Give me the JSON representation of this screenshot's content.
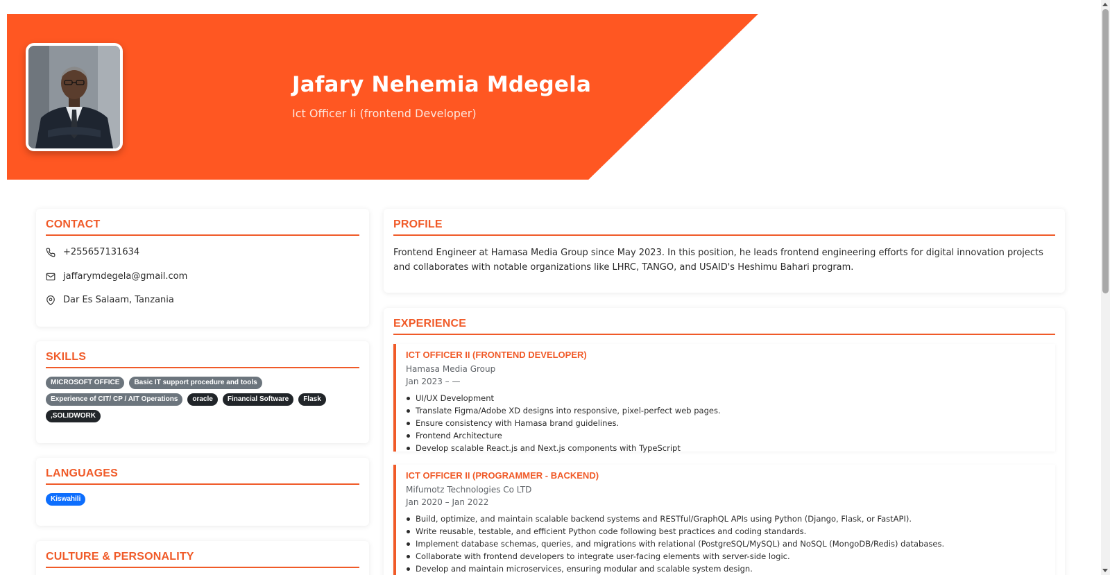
{
  "header": {
    "name": "Jafary Nehemia Mdegela",
    "role": "Ict Officer Ii (frontend Developer)",
    "accent_color": "#ff5722"
  },
  "contact": {
    "title": "CONTACT",
    "phone": "+255657131634",
    "email": "jaffarymdegela@gmail.com",
    "location": "Dar Es Salaam, Tanzania"
  },
  "skills": {
    "title": "SKILLS",
    "items": [
      {
        "label": "MICROSOFT OFFICE",
        "color": "#6c757d"
      },
      {
        "label": "Basic IT support procedure and tools",
        "color": "#6c757d"
      },
      {
        "label": "Experience of CIT/ CP / AIT Operations",
        "color": "#6c757d"
      },
      {
        "label": "oracle",
        "color": "#212529"
      },
      {
        "label": "Financial Software",
        "color": "#212529"
      },
      {
        "label": "Flask",
        "color": "#212529"
      },
      {
        "label": ",SOLIDWORK",
        "color": "#212529"
      }
    ]
  },
  "languages": {
    "title": "LANGUAGES",
    "items": [
      {
        "label": "Kiswahili",
        "color": "#0d6efd"
      }
    ]
  },
  "culture": {
    "title": "CULTURE & PERSONALITY"
  },
  "profile": {
    "title": "PROFILE",
    "text": "Frontend Engineer at Hamasa Media Group since May 2023. In this position, he leads frontend engineering efforts for digital innovation projects and collaborates with notable organizations like LHRC, TANGO, and USAID's Heshimu Bahari program."
  },
  "experience": {
    "title": "EXPERIENCE",
    "jobs": [
      {
        "title": "ICT OFFICER II (FRONTEND DEVELOPER)",
        "company": "Hamasa Media Group",
        "dates": "Jan 2023 – —",
        "bullets": [
          "UI/UX Development",
          "Translate Figma/Adobe XD designs into responsive, pixel-perfect web pages.",
          "Ensure consistency with Hamasa brand guidelines.",
          "Frontend Architecture",
          "Develop scalable React.js and Next.js components with TypeScript"
        ]
      },
      {
        "title": "ICT OFFICER II (PROGRAMMER - BACKEND)",
        "company": "Mifumotz Technologies Co LTD",
        "dates": "Jan 2020 – Jan 2022",
        "bullets": [
          "Build, optimize, and maintain scalable backend systems and RESTful/GraphQL APIs using Python (Django, Flask, or FastAPI).",
          "Write reusable, testable, and efficient Python code following best practices and coding standards.",
          "Implement database schemas, queries, and migrations with relational (PostgreSQL/MySQL) and NoSQL (MongoDB/Redis) databases.",
          "Collaborate with frontend developers to integrate user-facing elements with server-side logic.",
          "Develop and maintain microservices, ensuring modular and scalable system design."
        ]
      }
    ]
  }
}
